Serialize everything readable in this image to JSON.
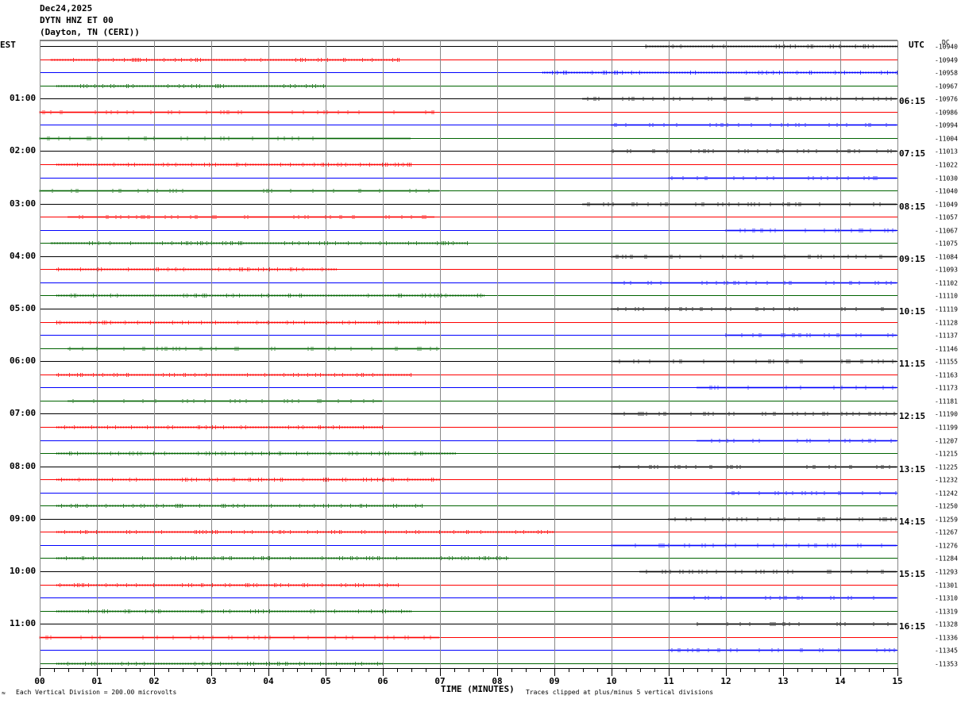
{
  "header": {
    "date": "Dec24,2025",
    "station": "DYTN HNZ ET 00",
    "location": "(Dayton, TN (CERI))"
  },
  "left_timezone": "EST",
  "right_timezone": "UTC",
  "dc_label": "DC",
  "footer": {
    "marker": "≈",
    "scale": "Each Vertical Division =  200.00 microvolts",
    "clip_note": "Traces clipped at plus/minus 5 vertical divisions"
  },
  "colors": {
    "black": "#000000",
    "red": "#ff0000",
    "blue": "#0000ff",
    "green": "#006400",
    "grid": "#888888"
  },
  "chart_data": {
    "type": "line",
    "xlabel": "TIME (MINUTES)",
    "xlim": [
      0,
      15
    ],
    "x_ticks": [
      "00",
      "01",
      "02",
      "03",
      "04",
      "05",
      "06",
      "07",
      "08",
      "09",
      "10",
      "11",
      "12",
      "13",
      "14",
      "15"
    ],
    "trace_color_cycle": [
      "black",
      "red",
      "blue",
      "green"
    ],
    "est_hour_labels": [
      "01:00",
      "02:00",
      "03:00",
      "04:00",
      "05:00",
      "06:00",
      "07:00",
      "08:00",
      "09:00",
      "10:00",
      "11:00"
    ],
    "utc_hour_labels": [
      "06:15",
      "07:15",
      "08:15",
      "09:15",
      "10:15",
      "11:15",
      "12:15",
      "13:15",
      "14:15",
      "15:15",
      "16:15"
    ],
    "dc_offsets": [
      "-10940",
      "-10949",
      "-10958",
      "-10967",
      "-10976",
      "-10986",
      "-10994",
      "-11004",
      "-11013",
      "-11022",
      "-11030",
      "-11040",
      "-11049",
      "-11057",
      "-11067",
      "-11075",
      "-11084",
      "-11093",
      "-11102",
      "-11110",
      "-11119",
      "-11128",
      "-11137",
      "-11146",
      "-11155",
      "-11163",
      "-11173",
      "-11181",
      "-11190",
      "-11199",
      "-11207",
      "-11215",
      "-11225",
      "-11232",
      "-11242",
      "-11250",
      "-11259",
      "-11267",
      "-11276",
      "-11284",
      "-11293",
      "-11301",
      "-11310",
      "-11319",
      "-11328",
      "-11336",
      "-11345",
      "-11353"
    ],
    "trace_extents_minutes": [
      [
        10.6,
        15
      ],
      [
        0.2,
        6.3
      ],
      [
        8.8,
        15
      ],
      [
        0.3,
        5.0
      ],
      [
        9.5,
        15
      ],
      [
        0.0,
        6.9
      ],
      [
        10.0,
        15
      ],
      [
        0.0,
        6.5
      ],
      [
        10.0,
        15
      ],
      [
        0.3,
        6.5
      ],
      [
        11.0,
        15
      ],
      [
        0.0,
        7.0
      ],
      [
        9.5,
        15
      ],
      [
        0.5,
        6.9
      ],
      [
        12.0,
        15
      ],
      [
        0.2,
        7.5
      ],
      [
        10.0,
        15
      ],
      [
        0.3,
        5.2
      ],
      [
        10.0,
        15
      ],
      [
        0.3,
        7.8
      ],
      [
        10.0,
        15
      ],
      [
        0.3,
        7.0
      ],
      [
        12.0,
        15
      ],
      [
        0.5,
        7.0
      ],
      [
        10.0,
        15
      ],
      [
        0.3,
        6.5
      ],
      [
        11.5,
        15
      ],
      [
        0.5,
        6.0
      ],
      [
        10.0,
        15
      ],
      [
        0.3,
        6.0
      ],
      [
        11.5,
        15
      ],
      [
        0.3,
        7.3
      ],
      [
        10.0,
        15
      ],
      [
        0.3,
        7.0
      ],
      [
        12.0,
        15
      ],
      [
        0.3,
        6.7
      ],
      [
        11.0,
        15
      ],
      [
        0.3,
        9.0
      ],
      [
        10.0,
        15
      ],
      [
        0.3,
        8.2
      ],
      [
        10.5,
        15
      ],
      [
        0.3,
        6.3
      ],
      [
        11.0,
        15
      ],
      [
        0.3,
        6.5
      ],
      [
        11.5,
        15
      ],
      [
        0.0,
        7.0
      ],
      [
        11.0,
        15
      ],
      [
        0.3,
        6.0
      ]
    ]
  }
}
